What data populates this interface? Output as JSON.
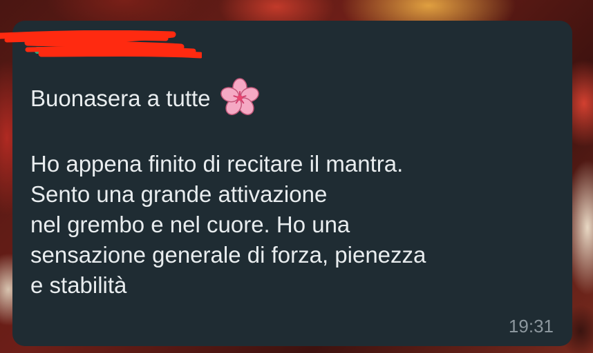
{
  "message": {
    "greeting": "Buonasera a tutte",
    "emoji_icon": "cherry-blossom-icon",
    "body_lines": [
      "Ho appena finito di recitare il mantra.",
      "Sento una grande attivazione",
      "nel grembo e nel cuore. Ho una",
      "sensazione generale di forza, pienezza",
      "e stabilità"
    ],
    "time": "19:31"
  },
  "colors": {
    "bubble_background": "#1f2c33",
    "text": "#e9edef",
    "timestamp": "#8c979e",
    "redaction_marker": "#ff2a10",
    "sender_name_hint": "#35c58f"
  }
}
